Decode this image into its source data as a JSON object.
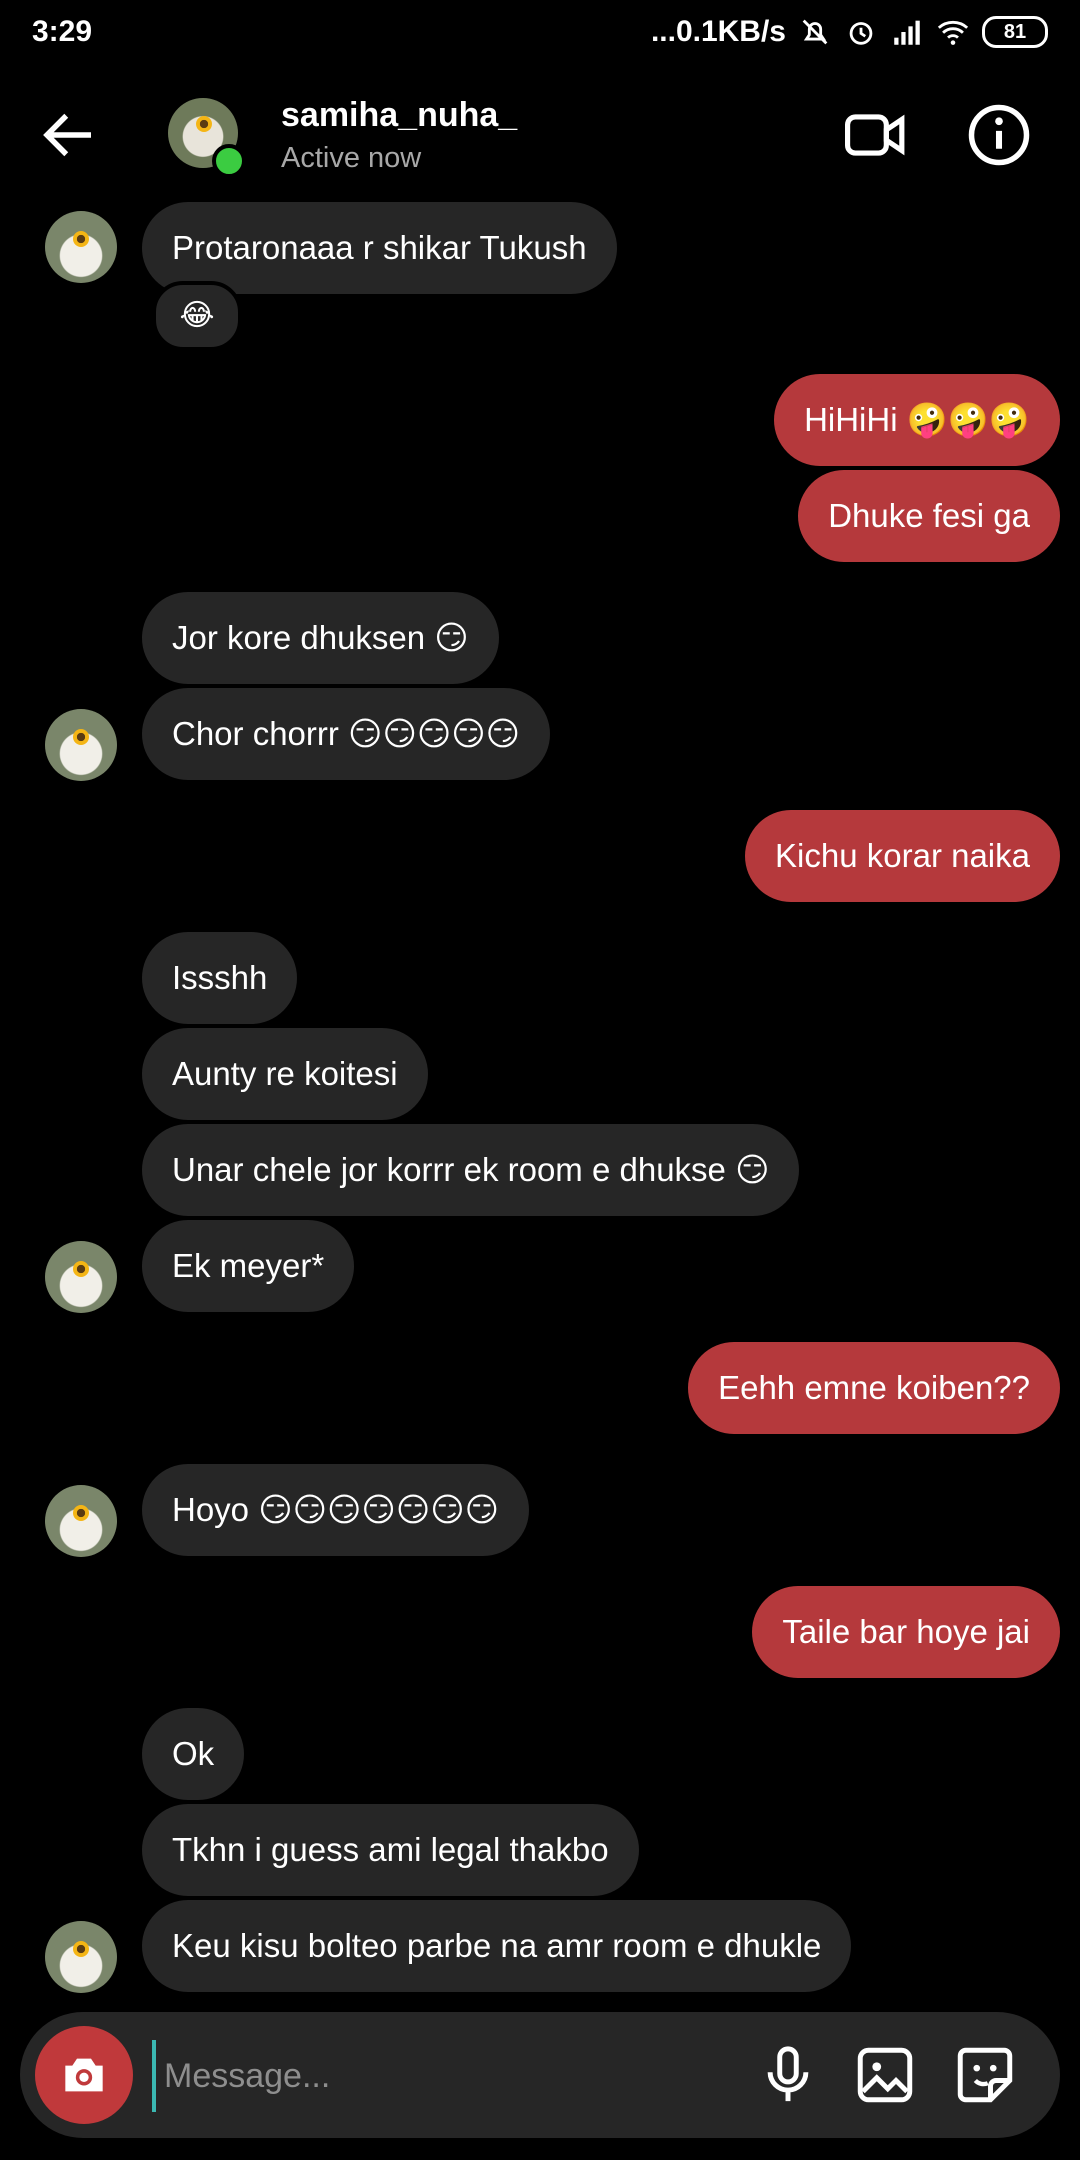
{
  "status_bar": {
    "time": "3:29",
    "network_speed": "...0.1KB/s",
    "battery": "81"
  },
  "header": {
    "username": "samiha_nuha_",
    "status": "Active now"
  },
  "messages": [
    {
      "dir": "in",
      "text": "Protaronaaa r shikar Tukush",
      "reaction": "😂"
    },
    {
      "dir": "out",
      "text": "HiHiHi 🤪🤪🤪"
    },
    {
      "dir": "out",
      "text": "Dhuke fesi ga"
    },
    {
      "dir": "in",
      "text": "Jor kore dhuksen 😏"
    },
    {
      "dir": "in",
      "text": "Chor chorrr 😏😏😏😏😏"
    },
    {
      "dir": "out",
      "text": "Kichu korar naika"
    },
    {
      "dir": "in",
      "text": "Issshh"
    },
    {
      "dir": "in",
      "text": "Aunty re koitesi"
    },
    {
      "dir": "in",
      "text": "Unar chele jor korrr ek room e dhukse 😏"
    },
    {
      "dir": "in",
      "text": "Ek meyer*"
    },
    {
      "dir": "out",
      "text": "Eehh emne koiben??"
    },
    {
      "dir": "in",
      "text": "Hoyo 😏😏😏😏😏😏😏"
    },
    {
      "dir": "out",
      "text": "Taile bar hoye jai"
    },
    {
      "dir": "in",
      "text": "Ok"
    },
    {
      "dir": "in",
      "text": "Tkhn i guess ami legal thakbo"
    },
    {
      "dir": "in",
      "text": "Keu kisu bolteo parbe na amr room e dhukle"
    }
  ],
  "composer": {
    "placeholder": "Message..."
  },
  "icons": {
    "back": "back-arrow-icon",
    "video": "video-call-icon",
    "info": "info-icon",
    "camera": "camera-icon",
    "mic": "microphone-icon",
    "gallery": "gallery-icon",
    "sticker": "sticker-icon"
  },
  "colors": {
    "background": "#000000",
    "incoming_bubble": "#262626",
    "outgoing_bubble": "#b5393c",
    "online": "#3bcc41"
  }
}
